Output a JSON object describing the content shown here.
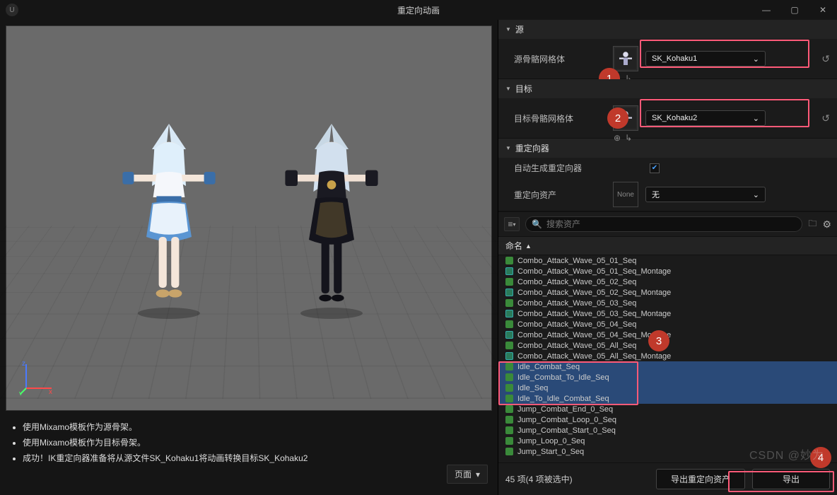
{
  "window": {
    "title": "重定向动画"
  },
  "viewport": {
    "info_lines": [
      "使用Mixamo模板作为源骨架。",
      "使用Mixamo模板作为目标骨架。",
      "成功！IK重定向器准备将从源文件SK_Kohaku1将动画转换目标SK_Kohaku2"
    ],
    "pager_label": "页面"
  },
  "panels": {
    "source": {
      "header": "源",
      "mesh_label": "源骨骼网格体",
      "mesh_value": "SK_Kohaku1"
    },
    "target": {
      "header": "目标",
      "mesh_label": "目标骨骼网格体",
      "mesh_value": "SK_Kohaku2"
    },
    "retargeter": {
      "header": "重定向器",
      "auto_label": "自动生成重定向器",
      "asset_label": "重定向资产",
      "asset_none": "None",
      "asset_value": "无"
    }
  },
  "search": {
    "placeholder": "搜索资产"
  },
  "column_header": "命名",
  "assets": [
    {
      "label": "Combo_Attack_Wave_05_01_Seq",
      "icon": "green",
      "sel": false
    },
    {
      "label": "Combo_Attack_Wave_05_01_Seq_Montage",
      "icon": "blue",
      "sel": false
    },
    {
      "label": "Combo_Attack_Wave_05_02_Seq",
      "icon": "green",
      "sel": false
    },
    {
      "label": "Combo_Attack_Wave_05_02_Seq_Montage",
      "icon": "blue",
      "sel": false
    },
    {
      "label": "Combo_Attack_Wave_05_03_Seq",
      "icon": "green",
      "sel": false
    },
    {
      "label": "Combo_Attack_Wave_05_03_Seq_Montage",
      "icon": "blue",
      "sel": false
    },
    {
      "label": "Combo_Attack_Wave_05_04_Seq",
      "icon": "green",
      "sel": false
    },
    {
      "label": "Combo_Attack_Wave_05_04_Seq_Montage",
      "icon": "blue",
      "sel": false
    },
    {
      "label": "Combo_Attack_Wave_05_All_Seq",
      "icon": "green",
      "sel": false
    },
    {
      "label": "Combo_Attack_Wave_05_All_Seq_Montage",
      "icon": "blue",
      "sel": false
    },
    {
      "label": "Idle_Combat_Seq",
      "icon": "green",
      "sel": true
    },
    {
      "label": "Idle_Combat_To_Idle_Seq",
      "icon": "green",
      "sel": true
    },
    {
      "label": "Idle_Seq",
      "icon": "green",
      "sel": true
    },
    {
      "label": "Idle_To_Idle_Combat_Seq",
      "icon": "green",
      "sel": true
    },
    {
      "label": "Jump_Combat_End_0_Seq",
      "icon": "green",
      "sel": false
    },
    {
      "label": "Jump_Combat_Loop_0_Seq",
      "icon": "green",
      "sel": false
    },
    {
      "label": "Jump_Combat_Start_0_Seq",
      "icon": "green",
      "sel": false
    },
    {
      "label": "Jump_Loop_0_Seq",
      "icon": "green",
      "sel": false
    },
    {
      "label": "Jump_Start_0_Seq",
      "icon": "green",
      "sel": false
    }
  ],
  "footer": {
    "status": "45 项(4 项被选中)",
    "btn_export": "导出重定向资产",
    "btn_export2": "导出"
  },
  "badges": {
    "b1": "1",
    "b2": "2",
    "b3": "3",
    "b4": "4"
  },
  "watermark": "CSDN @妙为"
}
